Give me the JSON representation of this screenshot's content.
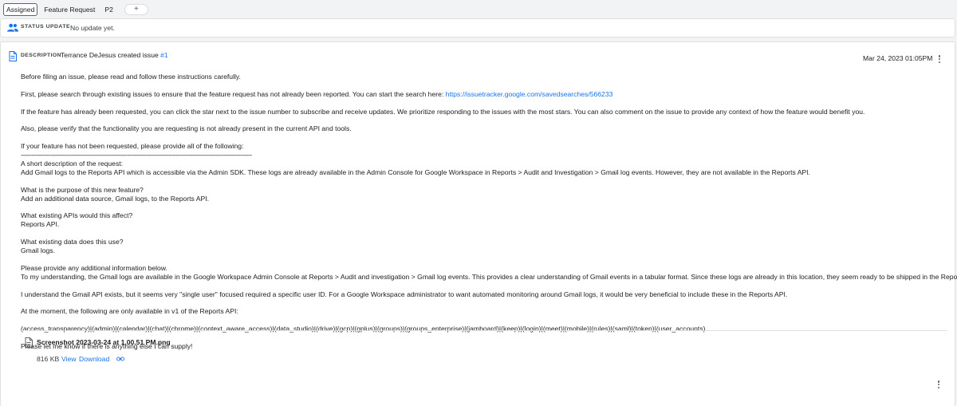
{
  "chips": {
    "assigned": "Assigned",
    "feature_request": "Feature Request",
    "priority": "P2",
    "add": "+"
  },
  "status": {
    "label": "STATUS UPDATE",
    "value": "No update yet."
  },
  "description": {
    "label": "DESCRIPTION",
    "author_text": "Terrance DeJesus created issue",
    "issue_link": "#1",
    "date": "Mar 24, 2023 01:05PM",
    "lines": {
      "l1": "Before filing an issue, please read and follow these instructions carefully.",
      "l2a": "First, please search through existing issues to ensure that the feature request has not already been reported. You can start the search here: ",
      "l2b": "https://issuetracker.google.com/savedsearches/566233",
      "l3": "If the feature has already been requested, you can click the star next to the issue number to subscribe and receive updates. We prioritize responding to the issues with the most stars. You can also comment on the issue to provide any context of how the feature would benefit you.",
      "l4": "Also, please verify that the functionality you are requesting is not already present in the current API and tools.",
      "l5": "If your feature has not been requested, please provide all of the following:",
      "l6": "-----------------------------------------------------------------------------------------------------------------------------------------------------------------------------------",
      "l7": "A short description of the request:",
      "l8": "Add Gmail logs to the Reports API which is accessible via the Admin SDK. These logs are already available in the Admin Console for Google Workspace in Reports > Audit and Investigation > Gmail log events. However, they are not available in the Reports API.",
      "l9": "What is the purpose of this new feature?",
      "l10": "Add an additional data source, Gmail logs, to the Reports API.",
      "l11": "What existing APIs would this affect?",
      "l12": "Reports API.",
      "l13": "What existing data does this use?",
      "l14": "Gmail logs.",
      "l15": "Please provide any additional information below.",
      "l16": "To my understanding, the Gmail logs are available in the Google Workspace Admin Console at Reports > Audit and investigation > Gmail log events. This provides a clear understanding of Gmail events in a tabular format. Since these logs are already in this location, they seem ready to be shipped in the Reports API as well.",
      "l17": "I understand the Gmail API exists, but it seems very \"single user\" focused required a specific user ID. For a Google Workspace administrator to want automated monitoring around Gmail logs, it would be very beneficial to include these in the Reports API.",
      "l18": "At the moment, the following are only available in v1 of the Reports API:",
      "l19": "(access_transparency)|(admin)|(calendar)|(chat)|(chrome)|(context_aware_access)|(data_studio)|(drive)|(gcp)|(gplus)|(groups)|(groups_enterprise)|(jamboard)|(keep)|(login)|(meet)|(mobile)|(rules)|(saml)|(token)|(user_accounts)",
      "l20": "Please let me know if there is anything else I can supply!"
    }
  },
  "attachment": {
    "name": "Screenshot 2023-03-24 at 1.00.51 PM.png",
    "size": "816 KB",
    "view": "View",
    "download": "Download"
  },
  "icons": {
    "status": "people-icon",
    "description": "document-icon",
    "attachment": "document-icon",
    "more": "more-vert-icon",
    "link": "link-icon"
  },
  "colors": {
    "link": "#1a73e8",
    "icon_blue": "#1a73e8"
  }
}
